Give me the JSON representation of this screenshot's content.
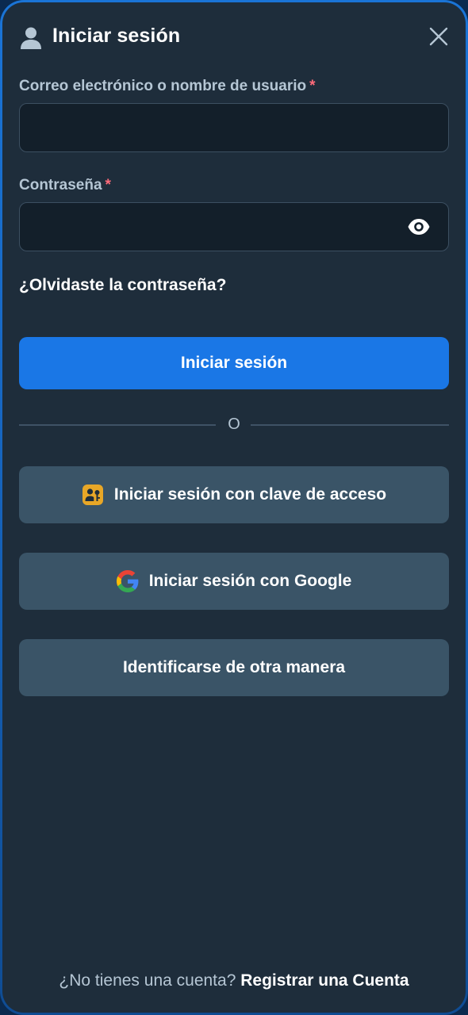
{
  "header": {
    "title": "Iniciar sesión"
  },
  "form": {
    "username_label": "Correo electrónico o nombre de usuario",
    "username_value": "",
    "password_label": "Contraseña",
    "password_value": "",
    "required_mark": "*",
    "forgot_link": "¿Olvidaste la contraseña?",
    "submit_label": "Iniciar sesión"
  },
  "divider": {
    "text": "O"
  },
  "alternatives": {
    "passkey_label": "Iniciar sesión con clave de acceso",
    "google_label": "Iniciar sesión con Google",
    "other_label": "Identificarse de otra manera"
  },
  "footer": {
    "prompt": "¿No tienes una cuenta?",
    "register_link": "Registrar una Cuenta"
  },
  "colors": {
    "panel_bg": "#1e2d3b",
    "accent": "#1a77e6",
    "secondary_button": "#3a5467",
    "required": "#ff6b7a",
    "passkey_icon": "#e8a727"
  }
}
